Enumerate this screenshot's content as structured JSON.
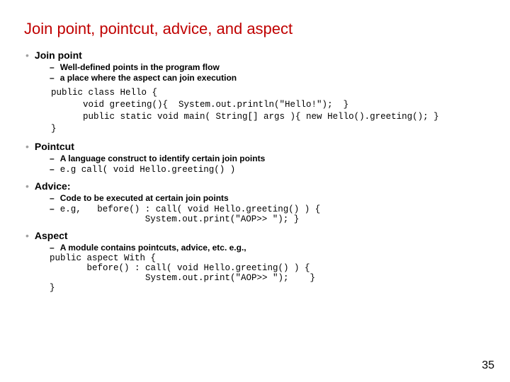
{
  "title": "Join point, pointcut, advice, and aspect",
  "sections": [
    {
      "heading": "Join point",
      "subs": [
        "Well-defined points in the program flow",
        "a place where the aspect can join execution"
      ],
      "code": "public class Hello {\n      void greeting(){  System.out.println(\"Hello!\");  }\n      public static void main( String[] args ){ new Hello().greeting(); }\n}"
    },
    {
      "heading": "Pointcut",
      "subs": [
        "A language construct to identify certain join points",
        "e.g call( void Hello.greeting() )"
      ]
    },
    {
      "heading": "Advice:",
      "subs": [
        "Code to be executed at certain join points",
        "e.g,   before() : call( void Hello.greeting() ) {\n                System.out.print(\"AOP>> \"); }"
      ]
    },
    {
      "heading": "Aspect",
      "subs": [
        "A module contains pointcuts, advice, etc. e.g.,"
      ],
      "tail_code": "public aspect With {\n       before() : call( void Hello.greeting() ) {\n                  System.out.print(\"AOP>> \");    }\n}"
    }
  ],
  "page_number": "35"
}
